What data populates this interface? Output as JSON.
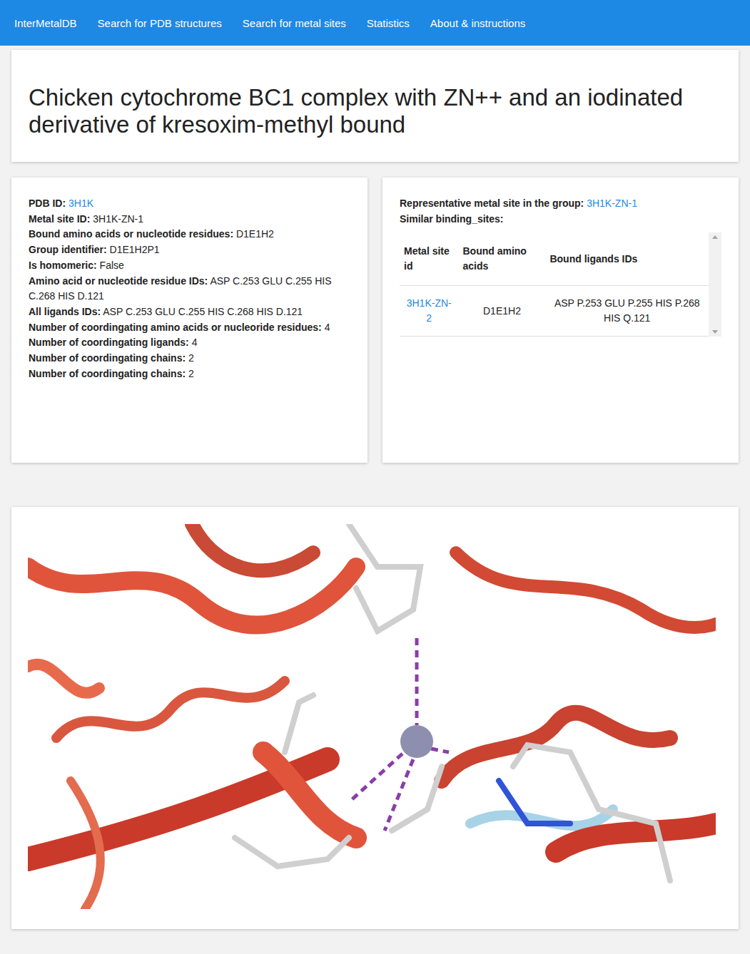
{
  "nav": {
    "brand": "InterMetalDB",
    "items": [
      "Search for PDB structures",
      "Search for metal sites",
      "Statistics",
      "About & instructions"
    ]
  },
  "title": "Chicken cytochrome BC1 complex with ZN++ and an iodinated derivative of kresoxim-methyl bound",
  "details": [
    {
      "label": "PDB ID:",
      "value": "3H1K",
      "kind": "link"
    },
    {
      "label": "Metal site ID:",
      "value": "3H1K-ZN-1",
      "kind": "text"
    },
    {
      "label": "Bound amino acids or nucleotide residues:",
      "value": "D1E1H2",
      "kind": "text"
    },
    {
      "label": "Group identifier:",
      "value": "D1E1H2P1",
      "kind": "text"
    },
    {
      "label": "Is homomeric:",
      "value": "False",
      "kind": "text"
    },
    {
      "label": "Amino acid or nucleotide residue IDs:",
      "value": "ASP C.253 GLU C.255 HIS C.268 HIS D.121",
      "kind": "text"
    },
    {
      "label": "All ligands IDs:",
      "value": "ASP C.253 GLU C.255 HIS C.268 HIS D.121",
      "kind": "text"
    },
    {
      "label": "Number of coordingating amino acids or nucleoride residues:",
      "value": "4",
      "kind": "text"
    },
    {
      "label": "Number of coordingating ligands:",
      "value": "4",
      "kind": "text"
    },
    {
      "label": "Number of coordingating chains:",
      "value": "2",
      "kind": "text"
    },
    {
      "label": "Number of coordingating chains:",
      "value": "2",
      "kind": "text"
    }
  ],
  "group": {
    "label": "Representative metal site in the group:",
    "value": "3H1K-ZN-1",
    "similar_label": "Similar binding_sites:",
    "columns": [
      "Metal site id",
      "Bound amino acids",
      "Bound ligands IDs"
    ],
    "rows": [
      {
        "site": "3H1K-ZN-2",
        "amino": "D1E1H2",
        "ligands": "ASP P.253 GLU P.255 HIS P.268 HIS Q.121"
      }
    ]
  }
}
